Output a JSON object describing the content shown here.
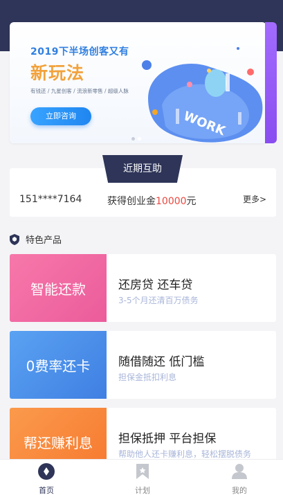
{
  "banner": {
    "subtitle": "2019下半场创客又有",
    "title": "新玩法",
    "tags": "有钱还 / 九星创客 / 流浪新零售 / 超级人脉",
    "cta_label": "立即咨询",
    "art_text": "WORK",
    "colors": {
      "cta": "#2a8ff5",
      "title": "#f2a23b",
      "subtitle": "#2f7fe0",
      "side_accent": "#9a5ef8"
    }
  },
  "recent": {
    "tab_label": "近期互助",
    "phone": "151****7164",
    "msg_prefix": "获得创业金",
    "amount": "10000",
    "msg_suffix": "元",
    "more_label": "更多>"
  },
  "featured": {
    "title": "特色产品",
    "icon": "shield-icon",
    "items": [
      {
        "swatch_label": "智能还款",
        "title": "还房贷 还车贷",
        "desc": "3-5个月还清百万债务",
        "color": "#f06aa3"
      },
      {
        "swatch_label": "0费率还卡",
        "title": "随借随还 低门槛",
        "desc": "担保金抵扣利息",
        "color": "#4d8fe8"
      },
      {
        "swatch_label": "帮还赚利息",
        "title": "担保抵押 平台担保",
        "desc": "帮助他人还卡赚利息，轻松摆脱债务",
        "color": "#f98a3c"
      }
    ]
  },
  "tabbar": {
    "items": [
      {
        "label": "首页",
        "icon": "home-icon",
        "active": true
      },
      {
        "label": "计划",
        "icon": "bookmark-icon",
        "active": false
      },
      {
        "label": "我的",
        "icon": "user-icon",
        "active": false
      }
    ],
    "colors": {
      "active": "#2e3558",
      "inactive": "#bfc2c8"
    }
  }
}
